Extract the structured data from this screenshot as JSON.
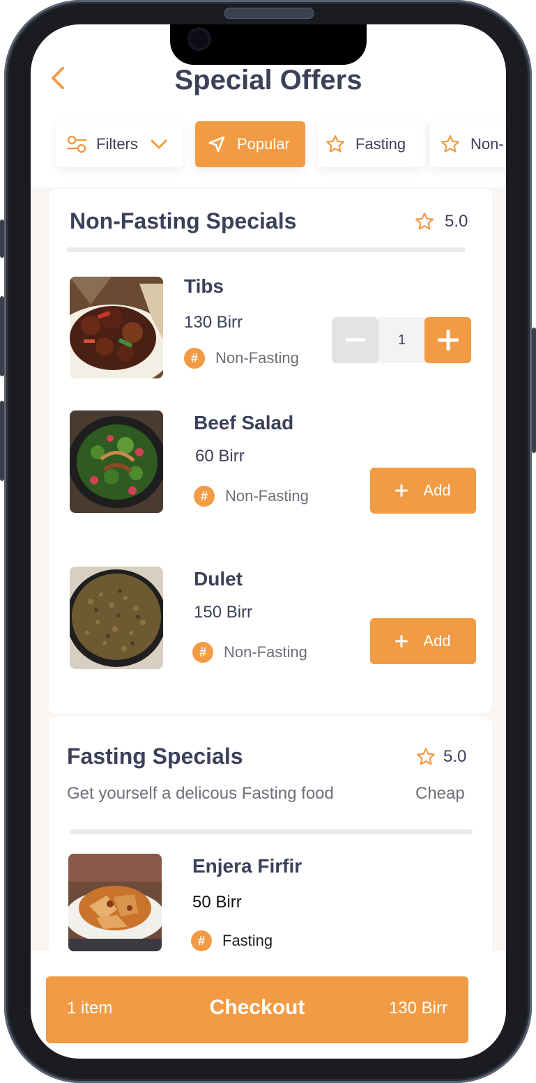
{
  "header": {
    "back_icon": "chevron-left-icon",
    "title": "Special Offers"
  },
  "chips": [
    {
      "label": "Filters",
      "icon": "sliders-icon",
      "trailing_icon": "chevron-down-icon"
    },
    {
      "label": "Popular",
      "icon": "navigation-arrow-icon",
      "active": true
    },
    {
      "label": "Fasting",
      "icon": "star-icon"
    },
    {
      "label": "Non-",
      "icon": "star-icon"
    }
  ],
  "non_fasting": {
    "title": "Non-Fasting Specials",
    "rating": "5.0",
    "items": [
      {
        "name": "Tibs",
        "price": "130 Birr",
        "tag": "Non-Fasting",
        "quantity": "1"
      },
      {
        "name": "Beef Salad",
        "price": "60 Birr",
        "tag": "Non-Fasting",
        "action": "Add"
      },
      {
        "name": "Dulet",
        "price": "150 Birr",
        "tag": "Non-Fasting",
        "action": "Add"
      }
    ]
  },
  "fasting": {
    "title": "Fasting Specials",
    "rating": "5.0",
    "subtitle": "Get yourself a delicous Fasting food",
    "price_level": "Cheap",
    "items": [
      {
        "name": "Enjera Firfir",
        "price": "50 Birr",
        "tag": "Fasting"
      }
    ]
  },
  "checkout": {
    "count": "1 item",
    "label": "Checkout",
    "total": "130 Birr"
  },
  "colors": {
    "accent": "#f29b45",
    "text": "#3c4059",
    "muted": "#6e6e78"
  }
}
